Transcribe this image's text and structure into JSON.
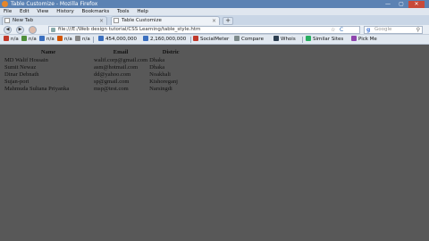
{
  "window": {
    "title": "Table Customize - Mozilla Firefox",
    "minimize": "—",
    "maximize": "▢",
    "close": "✕"
  },
  "menu": [
    "File",
    "Edit",
    "View",
    "History",
    "Bookmarks",
    "Tools",
    "Help"
  ],
  "tabs": [
    {
      "label": "New Tab",
      "active": false
    },
    {
      "label": "Table Customize",
      "active": true
    }
  ],
  "new_tab": "+",
  "nav": {
    "back": "◀",
    "forward": "▶",
    "url": "file:///E:/Web design tutorial/CSS Learning/table_style.htm",
    "search_placeholder": "Google",
    "search_engine": "g",
    "search_icon": "⚲",
    "reload": "C",
    "star": "☆"
  },
  "bookmarks": [
    {
      "label": "n/a",
      "icon": "mozilla-icon",
      "color": "#c0392b"
    },
    {
      "label": "n/a",
      "icon": "globe-icon",
      "color": "#4f8f3a"
    },
    {
      "label": "n/a",
      "icon": "globe-icon",
      "color": "#3a6fbf"
    },
    {
      "label": "n/a",
      "icon": "rank-icon",
      "color": "#d35400"
    },
    {
      "label": "n/a",
      "icon": "globe-icon",
      "color": "#888888"
    },
    {
      "label": "454,000,000",
      "icon": "link-icon",
      "color": "#3a6fbf"
    },
    {
      "label": "2,160,000,000",
      "icon": "link-icon",
      "color": "#3a6fbf"
    },
    {
      "label": "SocialMeter",
      "icon": "meter-icon",
      "color": "#c0392b"
    },
    {
      "label": "Compare",
      "icon": "compare-icon",
      "color": "#7f8c8d"
    },
    {
      "label": "Whois",
      "icon": "info-icon",
      "color": "#2c3e50"
    },
    {
      "label": "Similar Sites",
      "icon": "sites-icon",
      "color": "#27ae60"
    },
    {
      "label": "Pick Me",
      "icon": "pick-icon",
      "color": "#8e44ad"
    }
  ],
  "table": {
    "headers": [
      "Name",
      "Email",
      "Distric"
    ],
    "rows": [
      [
        "MD Walif Hossain",
        "walif.corp@gmail.com",
        "Dhaka"
      ],
      [
        "Sumit Newaz",
        "asm@hotmail.com",
        "Dhaka"
      ],
      [
        "Dinar Debnath",
        "dd@yahoo.com",
        "Noakhali"
      ],
      [
        "Sujan-pori",
        "sp@gmail.com",
        "Kishoreganj"
      ],
      [
        "Mahmuda Sultana Priyanka",
        "msp@test.com",
        "Narsingdi"
      ]
    ]
  }
}
